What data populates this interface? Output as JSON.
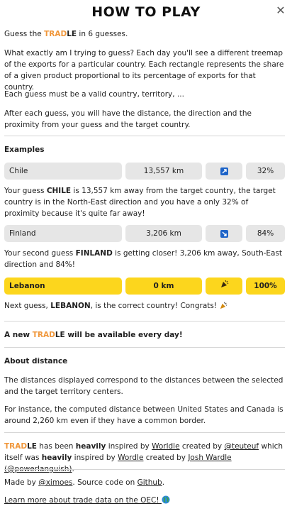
{
  "header": {
    "title": "HOW TO PLAY",
    "close_icon": "close-icon"
  },
  "intro": {
    "guess_prefix": "Guess the ",
    "brand_tra": "TRAD",
    "brand_le": "LE",
    "guess_suffix": " in 6 guesses.",
    "para2": "What exactly am I trying to guess? Each day you'll see a different treemap of the exports for a particular country. Each rectangle represents the share of a given product proportional to its percentage of exports for that country.",
    "para3": "Each guess must be a valid country, territory, ...",
    "para4": "After each guess, you will have the distance, the direction and the proximity from your guess and the target country."
  },
  "examples": {
    "heading": "Examples",
    "rows": [
      {
        "country": "Chile",
        "distance": "13,557 km",
        "direction_icon": "north-east-arrow-icon",
        "proximity": "32%"
      },
      {
        "country": "Finland",
        "distance": "3,206 km",
        "direction_icon": "south-east-arrow-icon",
        "proximity": "84%"
      },
      {
        "country": "Lebanon",
        "distance": "0 km",
        "direction_icon": "party-popper-icon",
        "proximity": "100%"
      }
    ],
    "desc1_a": "Your guess ",
    "desc1_b": "CHILE",
    "desc1_c": " is 13,557 km away from the target country, the target country is in the North-East direction and you have a only 32% of proximity because it's quite far away!",
    "desc2_a": "Your second guess ",
    "desc2_b": "FINLAND",
    "desc2_c": " is getting closer! 3,206 km away, South-East direction and 84%!",
    "desc3_a": "Next guess, ",
    "desc3_b": "LEBANON",
    "desc3_c": ", is the correct country! Congrats! ",
    "desc3_icon": "party-popper-icon"
  },
  "new_daily": {
    "a": "A new ",
    "tra": "TRAD",
    "le": "LE",
    "b": " will be available every day!"
  },
  "about": {
    "heading": "About distance",
    "p1": "The distances displayed correspond to the distances between the selected and the target territory centers.",
    "p2": "For instance, the computed distance between United States and Canada is around 2,260 km even if they have a common border."
  },
  "credits": {
    "tra": "TRAD",
    "le": "LE",
    "a": " has been ",
    "heavily": "heavily",
    "b": " inspired by ",
    "worldle": "Worldle",
    "c": " created by ",
    "teuteuf": "@teuteuf",
    "d": " which itself was ",
    "heavily2": "heavily",
    "e": " inspired by ",
    "wordle": "Wordle",
    "f": " created by ",
    "josh": "Josh Wardle (@powerlanguish)",
    "g": "."
  },
  "footer": {
    "made_a": "Made by ",
    "ximoes": "@ximoes",
    "made_b": ". Source code on ",
    "github": "Github",
    "made_c": ".",
    "learn": "Learn more about trade data on the OEC! ",
    "globe_icon": "globe-icon"
  }
}
